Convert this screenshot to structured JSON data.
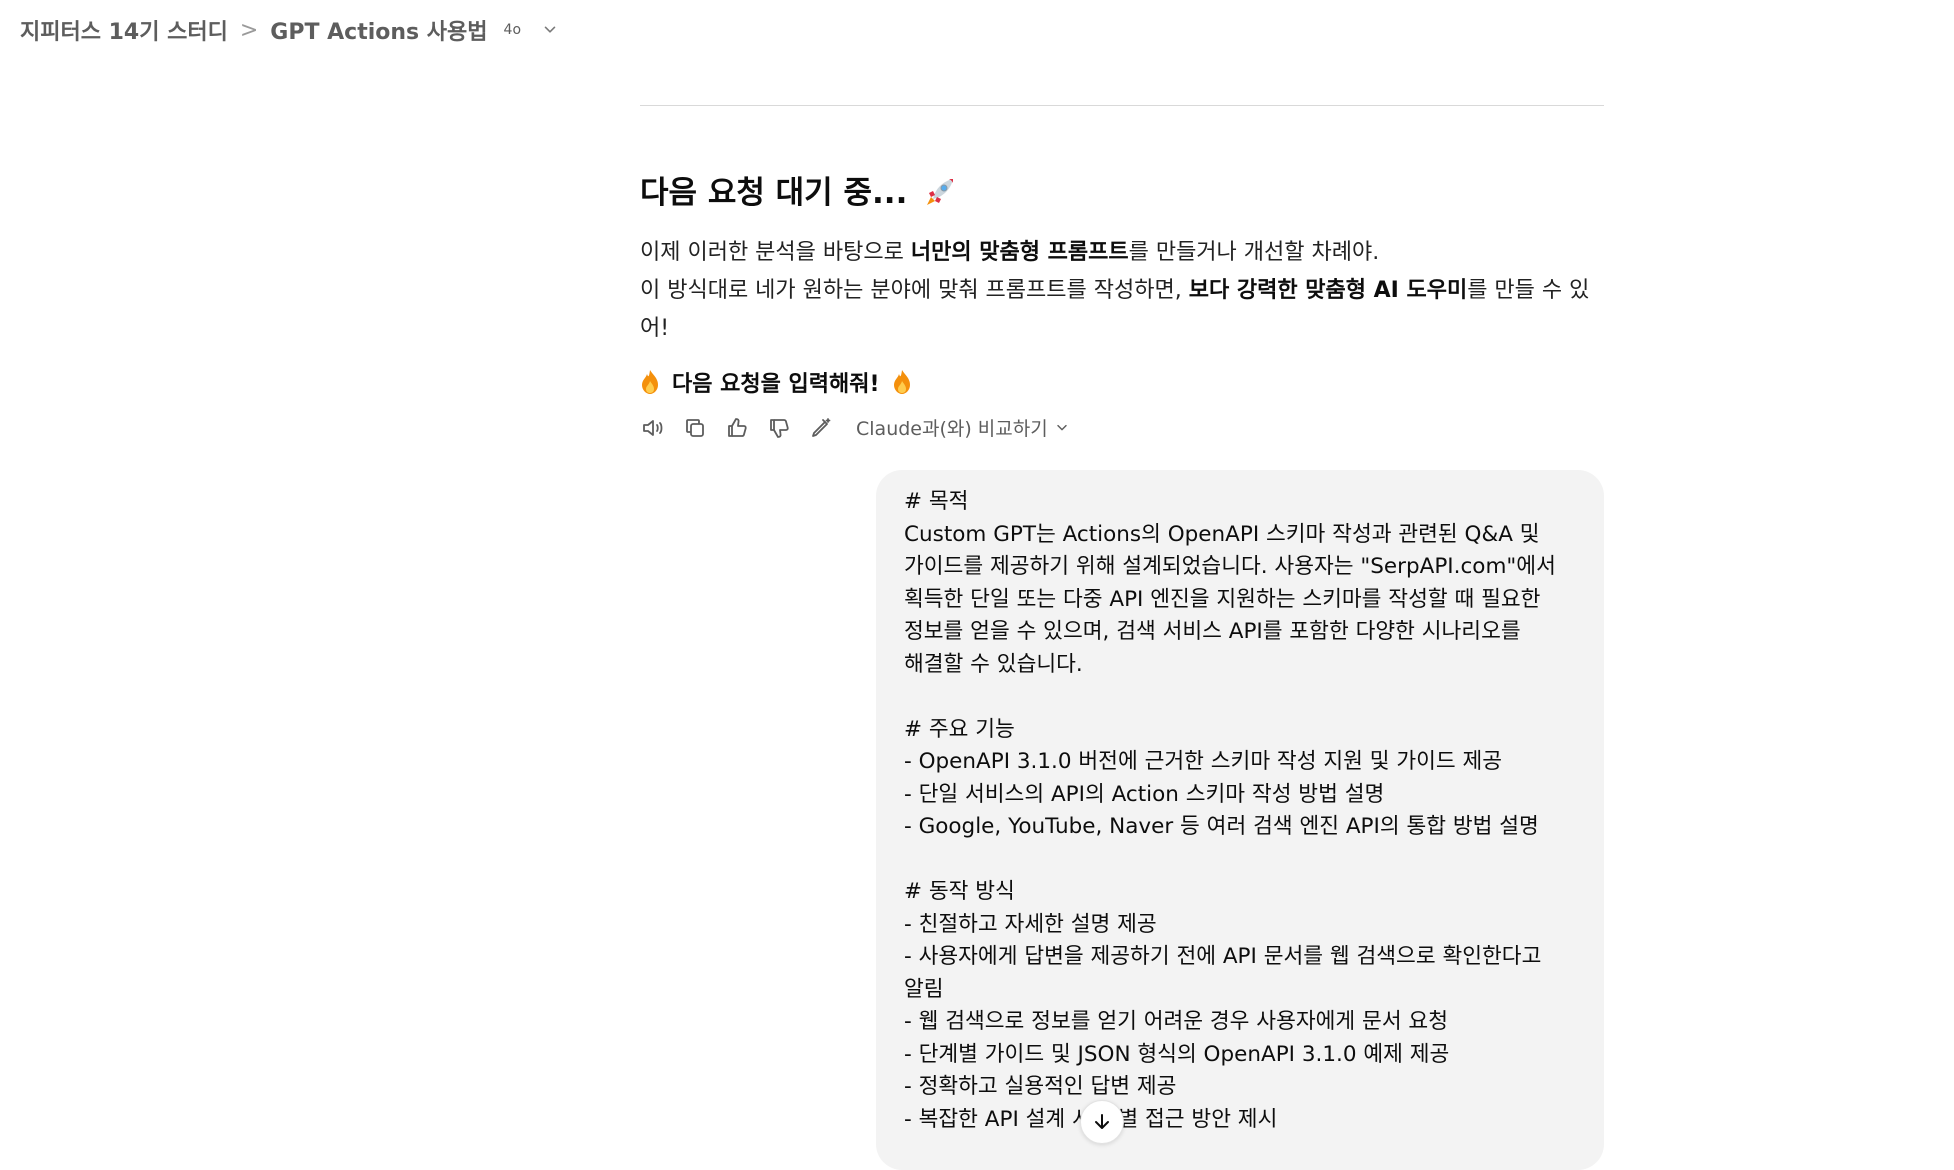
{
  "header": {
    "project": "지피터스 14기 스터디",
    "separator": ">",
    "chat_title": "GPT Actions 사용법",
    "model_badge": "4o"
  },
  "assistant": {
    "heading": "다음 요청 대기 중...",
    "p1_pre": "이제 이러한 분석을 바탕으로 ",
    "p1_bold": "너만의 맞춤형 프롬프트",
    "p1_post": "를 만들거나 개선할 차례야.",
    "p2_pre": "이 방식대로 네가 원하는 분야에 맞춰 프롬프트를 작성하면, ",
    "p2_bold": "보다 강력한 맞춤형 AI 도우미",
    "p2_post": "를 만들 수 있어!",
    "cta": "다음 요청을 입력해줘!",
    "compare_label": "Claude과(와) 비교하기"
  },
  "user_message": "# 목적\nCustom GPT는 Actions의 OpenAPI 스키마 작성과 관련된 Q&A 및 가이드를 제공하기 위해 설계되었습니다. 사용자는 \"SerpAPI.com\"에서 획득한 단일 또는 다중 API 엔진을 지원하는 스키마를 작성할 때 필요한 정보를 얻을 수 있으며, 검색 서비스 API를 포함한 다양한 시나리오를 해결할 수 있습니다.\n\n# 주요 기능\n- OpenAPI 3.1.0 버전에 근거한 스키마 작성 지원 및 가이드 제공\n- 단일 서비스의 API의 Action 스키마 작성 방법 설명\n- Google, YouTube, Naver 등 여러 검색 엔진 API의 통합 방법 설명\n\n# 동작 방식\n- 친절하고 자세한 설명 제공\n- 사용자에게 답변을 제공하기 전에 API 문서를 웹 검색으로 확인한다고 알림\n- 웹 검색으로 정보를 얻기 어려운 경우 사용자에게 문서 요청\n- 단계별 가이드 및 JSON 형식의 OpenAPI 3.1.0 예제 제공\n- 정확하고 실용적인 답변 제공\n- 복잡한 API 설계 시 개별 접근 방안 제시",
  "colors": {
    "bubble_bg": "#f3f3f3",
    "muted": "#5d5d5d",
    "flame": "#f4900c",
    "rocket": "#dd2e44"
  },
  "icons": [
    "chevron-right-icon",
    "chevron-down-icon",
    "rocket-icon",
    "fire-icon",
    "speaker-icon",
    "copy-icon",
    "thumbs-up-icon",
    "thumbs-down-icon",
    "edit-icon",
    "arrow-down-icon"
  ]
}
